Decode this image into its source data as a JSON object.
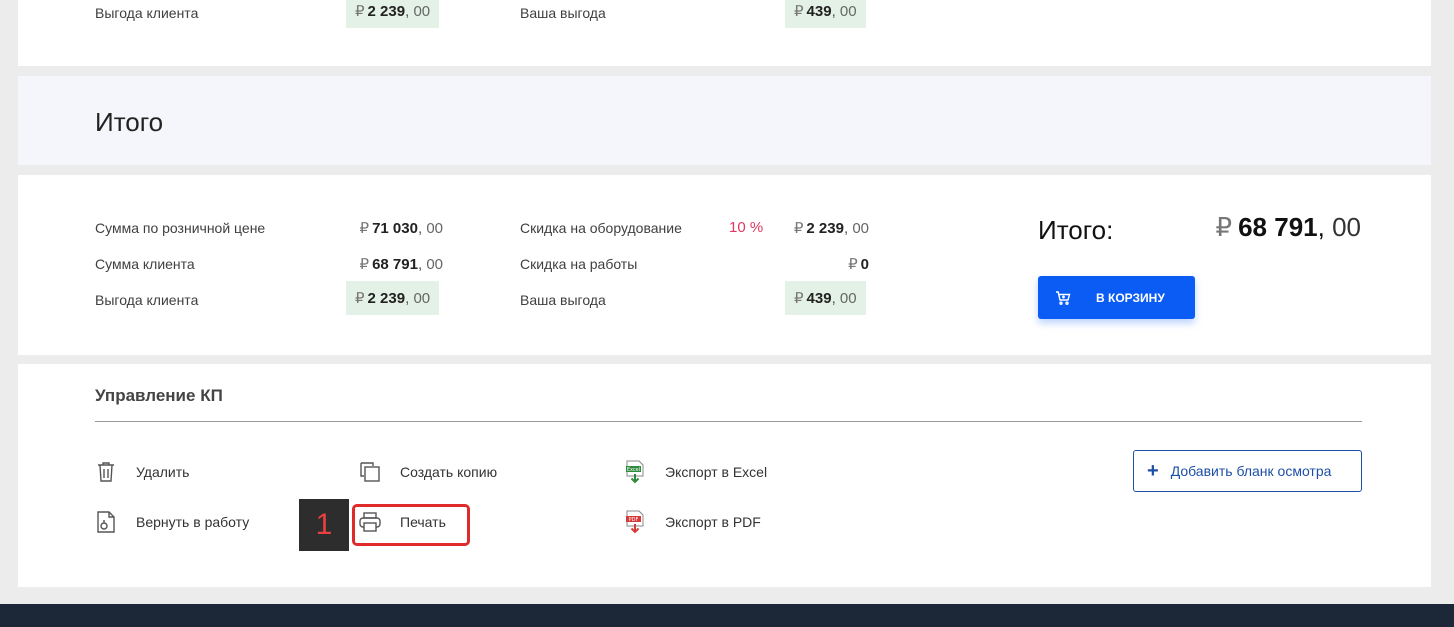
{
  "top": {
    "client_benefit_label": "Выгода клиента",
    "client_benefit": {
      "cur": "₽",
      "int": "2 239",
      "dec": "00"
    },
    "your_benefit_label": "Ваша выгода",
    "your_benefit": {
      "cur": "₽",
      "int": "439",
      "dec": "00"
    }
  },
  "section_title": "Итого",
  "totals": {
    "retail_sum_label": "Сумма по розничной цене",
    "retail_sum": {
      "cur": "₽",
      "int": "71 030",
      "dec": "00"
    },
    "client_sum_label": "Сумма клиента",
    "client_sum": {
      "cur": "₽",
      "int": "68 791",
      "dec": "00"
    },
    "client_benefit_label": "Выгода клиента",
    "client_benefit": {
      "cur": "₽",
      "int": "2 239",
      "dec": "00"
    },
    "equip_discount_label": "Скидка на оборудование",
    "equip_discount_pct": "10 %",
    "equip_discount": {
      "cur": "₽",
      "int": "2 239",
      "dec": "00"
    },
    "works_discount_label": "Скидка на работы",
    "works_discount": {
      "cur": "₽",
      "int": "0"
    },
    "your_benefit_label": "Ваша выгода",
    "your_benefit": {
      "cur": "₽",
      "int": "439",
      "dec": "00"
    },
    "grand_label": "Итого:",
    "grand": {
      "cur": "₽",
      "int": "68 791",
      "dec": "00"
    },
    "cart_button": "В КОРЗИНУ"
  },
  "manage": {
    "title": "Управление КП",
    "delete": "Удалить",
    "copy": "Создать копию",
    "export_excel": "Экспорт в Excel",
    "return": "Вернуть в работу",
    "print": "Печать",
    "export_pdf": "Экспорт в PDF",
    "add_inspection": "Добавить бланк осмотра",
    "step_badge": "1"
  },
  "colors": {
    "accent": "#0a5cf5",
    "highlight_bg": "#e3f1e6",
    "percent": "#e0385f",
    "callout": "#e02b2b",
    "footer": "#1c2838"
  }
}
